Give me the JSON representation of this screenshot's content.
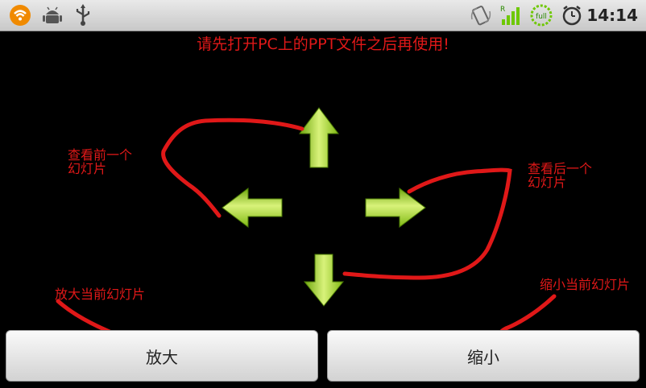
{
  "status_bar": {
    "icons": [
      "wifi-icon",
      "android-debug-icon",
      "usb-icon",
      "screen-rotate-icon",
      "signal-icon",
      "battery-full-icon",
      "alarm-icon"
    ],
    "battery_label": "full",
    "signal_label": "R",
    "time": "14:14"
  },
  "notice": "请先打开PC上的PPT文件之后再使用!",
  "annotations": {
    "prev_slide": "查看前一个\n幻灯片",
    "next_slide": "查看后一个\n幻灯片",
    "zoom_in": "放大当前幻灯片",
    "zoom_out": "缩小当前幻灯片"
  },
  "buttons": {
    "zoom_in": "放大",
    "zoom_out": "缩小"
  },
  "colors": {
    "accent_red": "#e01818",
    "arrow_green": "#9bd11a"
  }
}
